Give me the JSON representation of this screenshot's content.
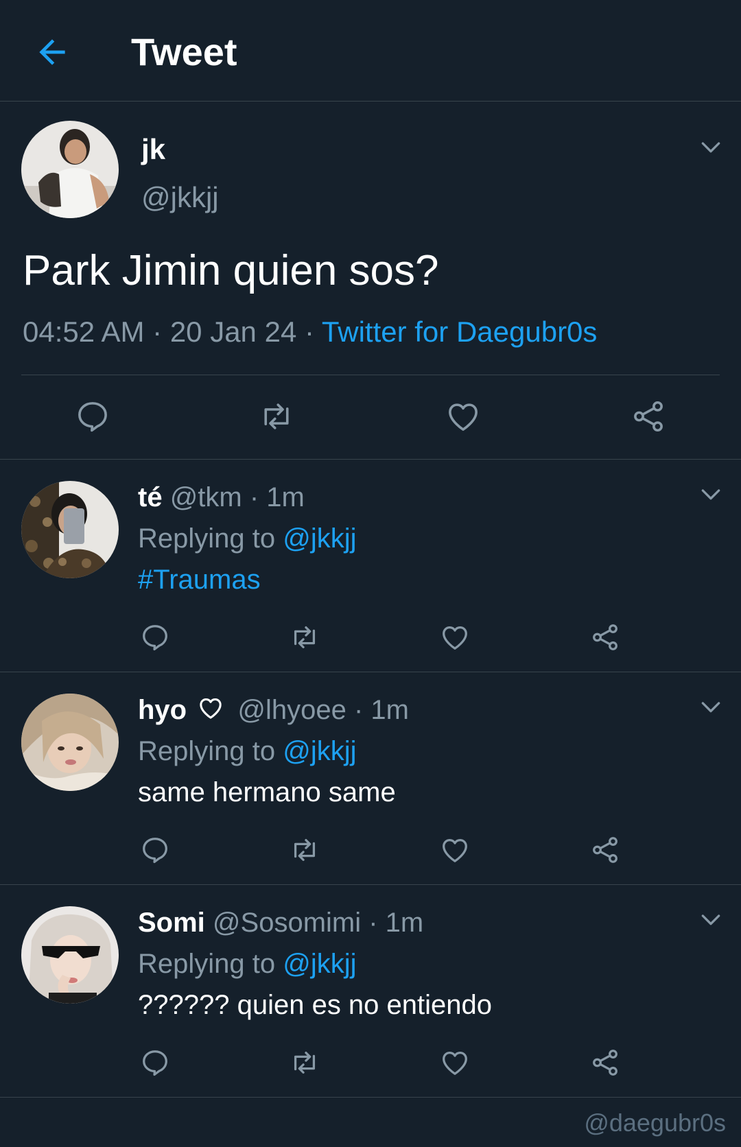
{
  "header": {
    "title": "Tweet",
    "back_icon": "arrow-left-icon"
  },
  "colors": {
    "background": "#15202b",
    "accent": "#1da1f2",
    "muted": "#8899a6",
    "divider": "#38444d"
  },
  "main_tweet": {
    "name": "jk",
    "handle": "@jkkjj",
    "text": "Park Jimin quien sos?",
    "time": "04:52 AM",
    "date": "20 Jan 24",
    "separator": "·",
    "source": "Twitter for Daegubr0s"
  },
  "replies": [
    {
      "name": "té",
      "handle": "@tkm",
      "time": "· 1m",
      "replying_label": "Replying to",
      "mention": "@jkkjj",
      "text": "#Traumas"
    },
    {
      "name": "hyo",
      "name_icon": "heart-outline-icon",
      "handle": "@lhyoee",
      "time": "· 1m",
      "replying_label": "Replying to",
      "mention": "@jkkjj",
      "text": "same hermano same"
    },
    {
      "name": "Somi",
      "handle": "@Sosomimi",
      "time": "· 1m",
      "replying_label": "Replying to",
      "mention": "@jkkjj",
      "text": "?????? quien es no entiendo"
    }
  ],
  "actions": [
    "reply-icon",
    "retweet-icon",
    "like-icon",
    "share-icon"
  ],
  "watermark": "@daegubr0s"
}
